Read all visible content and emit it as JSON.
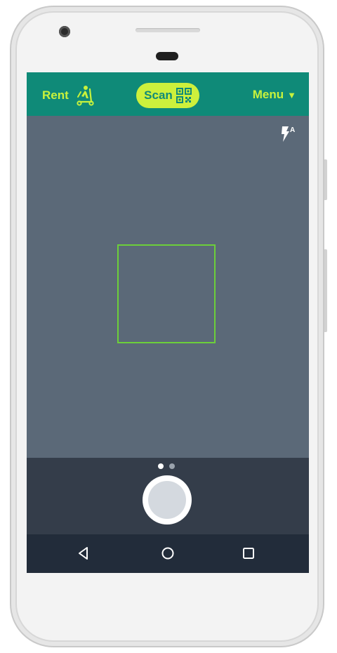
{
  "header": {
    "rent_label": "Rent",
    "scan_label": "Scan",
    "menu_label": "Menu",
    "menu_caret": "▼"
  },
  "camera_view": {
    "flash_mode_label": "A"
  },
  "bottom_panel": {
    "page_dots": 2,
    "active_page": 1
  },
  "nav": {
    "back_icon": "back-triangle-icon",
    "home_icon": "home-circle-icon",
    "recents_icon": "recents-square-icon"
  },
  "colors": {
    "topbar": "#0f8a78",
    "accent_lime": "#c8f23c",
    "scan_pill": "#cdf03c",
    "viewfinder": "#5b6978",
    "scan_frame": "#6ccf3a",
    "bottom_panel": "#343d4a",
    "nav_bar": "#222c3a"
  }
}
